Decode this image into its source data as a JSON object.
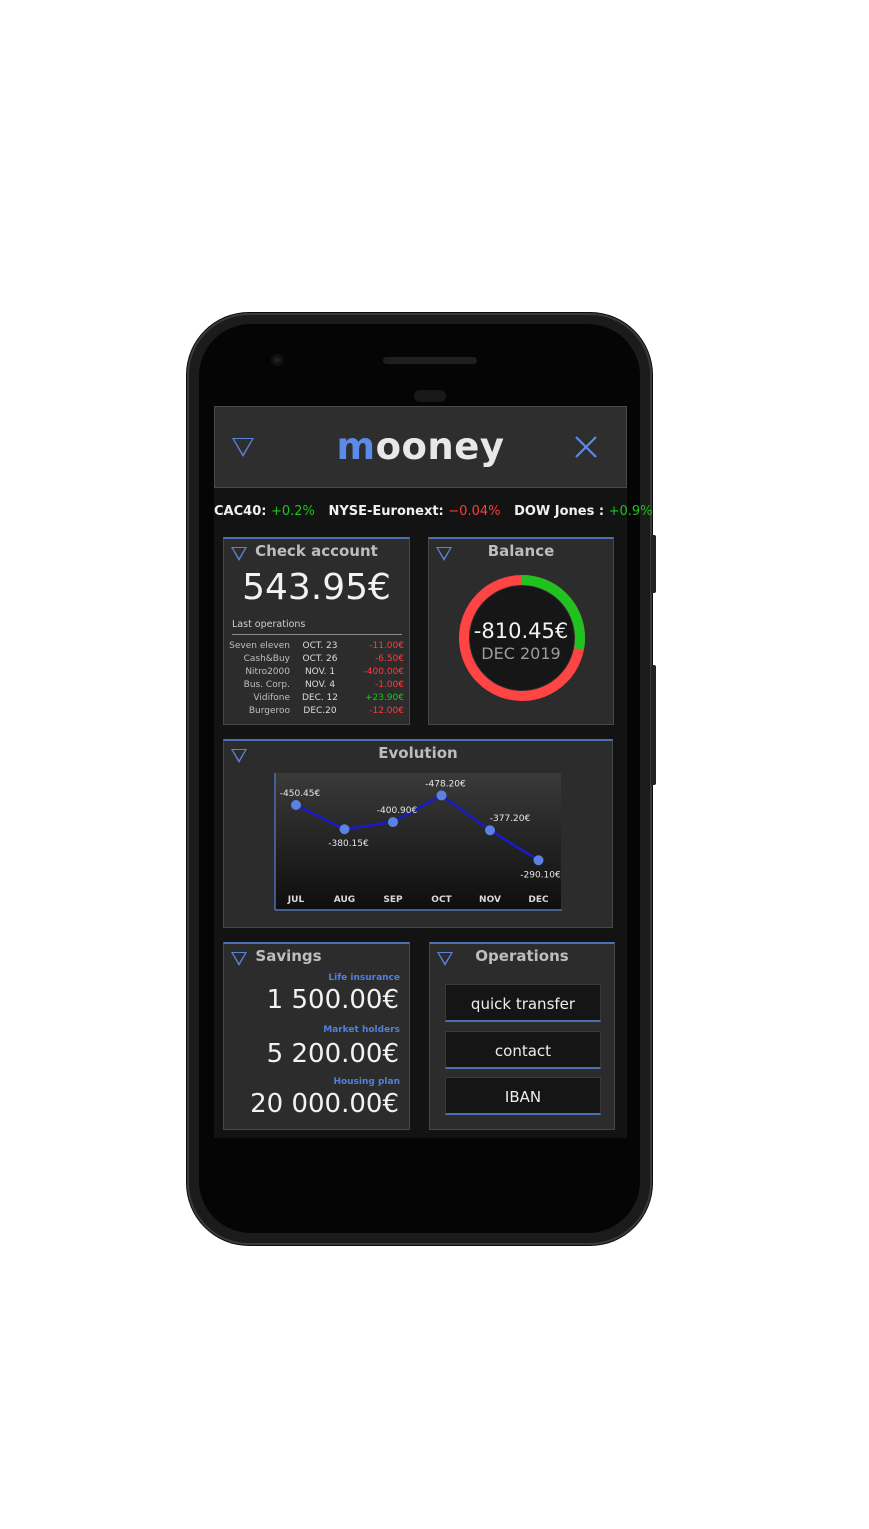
{
  "app": {
    "logo_first": "m",
    "logo_rest": "ooney"
  },
  "ticker": [
    {
      "name": "CAC40:",
      "value": "+0.2%",
      "trend": "up"
    },
    {
      "name": "NYSE-Euronext:",
      "value": "−0.04%",
      "trend": "down"
    },
    {
      "name": "DOW Jones :",
      "value": "+0.9%",
      "trend": "up"
    }
  ],
  "check_account": {
    "title": "Check account",
    "amount": "543.95€",
    "last_ops_label": "Last operations",
    "operations": [
      {
        "name": "Seven eleven",
        "date": "OCT. 23",
        "amount": "-11.00€",
        "trend": "down"
      },
      {
        "name": "Cash&Buy",
        "date": "OCT. 26",
        "amount": "-6.50€",
        "trend": "down"
      },
      {
        "name": "Nitro2000",
        "date": "NOV. 1",
        "amount": "-400.00€",
        "trend": "down"
      },
      {
        "name": "Bus. Corp.",
        "date": "NOV. 4",
        "amount": "-1.00€",
        "trend": "down"
      },
      {
        "name": "Vidifone",
        "date": "DEC. 12",
        "amount": "+23.90€",
        "trend": "up"
      },
      {
        "name": "Burgeroo",
        "date": "DEC.20",
        "amount": "-12.00€",
        "trend": "down"
      }
    ]
  },
  "balance": {
    "title": "Balance",
    "amount": "-810.45€",
    "period": "DEC 2019",
    "positive_fraction": 0.28,
    "colors": {
      "positive": "#1fc21f",
      "negative": "#ff4444"
    }
  },
  "evolution": {
    "title": "Evolution"
  },
  "chart_data": {
    "type": "line",
    "title": "Evolution",
    "categories": [
      "JUL",
      "AUG",
      "SEP",
      "OCT",
      "NOV",
      "DEC"
    ],
    "values": [
      -450.45,
      -380.15,
      -400.9,
      -478.2,
      -377.2,
      -290.1
    ],
    "labels": [
      "-450.45€",
      "-380.15€",
      "-400.90€",
      "-478.20€",
      "-377.20€",
      "-290.10€"
    ],
    "y_inverted": true,
    "ylim": [
      -520,
      -230
    ],
    "grid": false,
    "line_color": "#1a1acc",
    "point_color": "#5b82e0"
  },
  "savings": {
    "title": "Savings",
    "items": [
      {
        "label": "Life insurance",
        "amount": "1 500.00€"
      },
      {
        "label": "Market holders",
        "amount": "5 200.00€"
      },
      {
        "label": "Housing plan",
        "amount": "20 000.00€"
      }
    ]
  },
  "operations": {
    "title": "Operations",
    "buttons": [
      "quick transfer",
      "contact",
      "IBAN"
    ]
  }
}
